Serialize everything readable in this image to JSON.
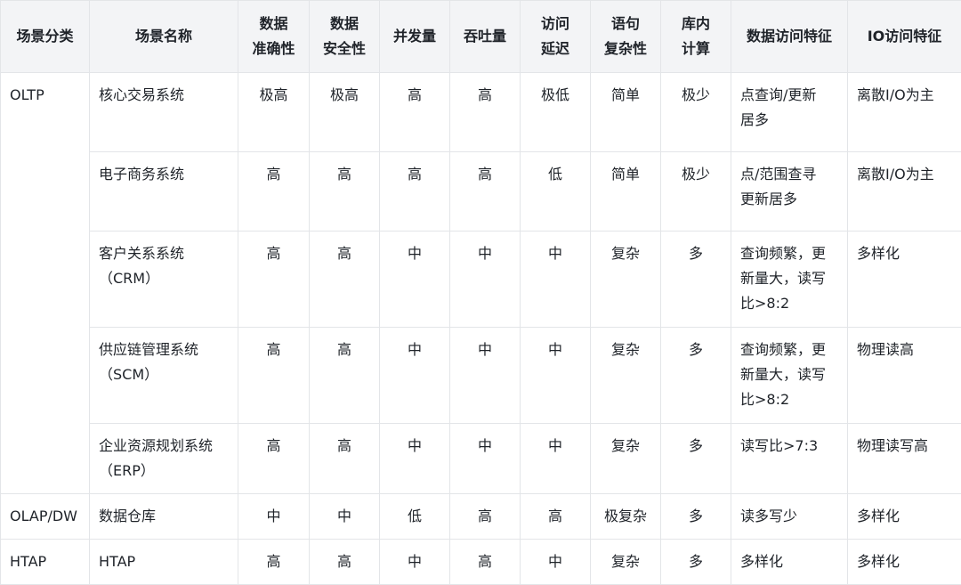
{
  "headers": [
    [
      "场景分类"
    ],
    [
      "场景名称"
    ],
    [
      "数据",
      "准确性"
    ],
    [
      "数据",
      "安全性"
    ],
    [
      "并发量"
    ],
    [
      "吞吐量"
    ],
    [
      "访问",
      "延迟"
    ],
    [
      "语句",
      "复杂性"
    ],
    [
      "库内",
      "计算"
    ],
    [
      "数据访问特征"
    ],
    [
      "IO访问特征"
    ]
  ],
  "categories": {
    "oltp": "OLTP",
    "olap": "OLAP/DW",
    "htap": "HTAP"
  },
  "rows": [
    {
      "name": [
        "核心交易系统"
      ],
      "accuracy": "极高",
      "security": "极高",
      "concurrency": "高",
      "throughput": "高",
      "latency": "极低",
      "complexity": "简单",
      "compute": "极少",
      "data_access": [
        "点查询/更新",
        "居多"
      ],
      "io_access": "离散I/O为主"
    },
    {
      "name": [
        "电子商务系统"
      ],
      "accuracy": "高",
      "security": "高",
      "concurrency": "高",
      "throughput": "高",
      "latency": "低",
      "complexity": "简单",
      "compute": "极少",
      "data_access": [
        "点/范围查寻",
        "更新居多"
      ],
      "io_access": "离散I/O为主"
    },
    {
      "name": [
        "客户关系系统",
        "（CRM）"
      ],
      "accuracy": "高",
      "security": "高",
      "concurrency": "中",
      "throughput": "中",
      "latency": "中",
      "complexity": "复杂",
      "compute": "多",
      "data_access": [
        "查询频繁，更",
        "新量大，读写",
        "比>8:2"
      ],
      "io_access": "多样化"
    },
    {
      "name": [
        "供应链管理系统",
        "（SCM）"
      ],
      "accuracy": "高",
      "security": "高",
      "concurrency": "中",
      "throughput": "中",
      "latency": "中",
      "complexity": "复杂",
      "compute": "多",
      "data_access": [
        "查询频繁，更",
        "新量大，读写",
        "比>8:2"
      ],
      "io_access": "物理读高"
    },
    {
      "name": [
        "企业资源规划系统",
        "（ERP）"
      ],
      "accuracy": "高",
      "security": "高",
      "concurrency": "中",
      "throughput": "中",
      "latency": "中",
      "complexity": "复杂",
      "compute": "多",
      "data_access": [
        "读写比>7:3"
      ],
      "io_access": "物理读写高"
    },
    {
      "name": [
        "数据仓库"
      ],
      "accuracy": "中",
      "security": "中",
      "concurrency": "低",
      "throughput": "高",
      "latency": "高",
      "complexity": "极复杂",
      "compute": "多",
      "data_access": [
        "读多写少"
      ],
      "io_access": "多样化"
    },
    {
      "name": [
        "HTAP"
      ],
      "accuracy": "高",
      "security": "高",
      "concurrency": "中",
      "throughput": "高",
      "latency": "中",
      "complexity": "复杂",
      "compute": "多",
      "data_access": [
        "多样化"
      ],
      "io_access": "多样化"
    }
  ]
}
